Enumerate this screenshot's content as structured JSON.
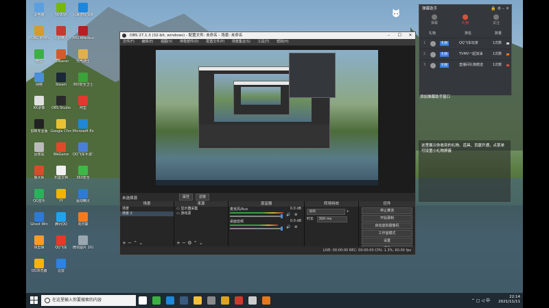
{
  "desktop_icons": [
    {
      "label": "此电脑",
      "color": "#5aa0e0"
    },
    {
      "label": "PUBG MYBSGM",
      "color": "#d89a2a"
    },
    {
      "label": "微信",
      "color": "#3cb043"
    },
    {
      "label": "网络",
      "color": "#4c8ed8"
    },
    {
      "label": "KK录像",
      "color": "#e0e0e0"
    },
    {
      "label": "剪映专业版",
      "color": "#222222"
    },
    {
      "label": "回收站",
      "color": "#bbbbbb"
    },
    {
      "label": "鲁大师",
      "color": "#d84c2c"
    },
    {
      "label": "QQ音乐",
      "color": "#2ab25a"
    },
    {
      "label": "Ghost Win",
      "color": "#2d7ad6"
    },
    {
      "label": "快剪辑",
      "color": "#ff9a2a"
    },
    {
      "label": "QQ浏览器",
      "color": "#f7b500"
    },
    {
      "label": "NVIDIA",
      "color": "#76b900"
    },
    {
      "label": "人脉精灵",
      "color": "#c23b2e"
    },
    {
      "label": "CCleaner",
      "color": "#d35b2b"
    },
    {
      "label": "Steam",
      "color": "#1b2838"
    },
    {
      "label": "OBS Studio",
      "color": "#2a2a2a"
    },
    {
      "label": "Google Chrome",
      "color": "#e8c232"
    },
    {
      "label": "WeGame",
      "color": "#e04a2a"
    },
    {
      "label": "石墨文档",
      "color": "#f0f0f0"
    },
    {
      "label": "YY",
      "color": "#f3b400"
    },
    {
      "label": "腾讯QQ",
      "color": "#22a3e8"
    },
    {
      "label": "QQ飞车",
      "color": "#e8382a"
    },
    {
      "label": "迅雷",
      "color": "#2d83e0"
    },
    {
      "label": "风暴游戏加速器",
      "color": "#1a87e0"
    },
    {
      "label": "MSI Afterburner",
      "color": "#b52020"
    },
    {
      "label": "元气骑士",
      "color": "#e2b04a"
    },
    {
      "label": "360安全卫士",
      "color": "#3aa33a"
    },
    {
      "label": "阿里",
      "color": "#e4382e"
    },
    {
      "label": "Microsoft Edge",
      "color": "#1f87d6"
    },
    {
      "label": "QQ飞车手游工具",
      "color": "#4a7fd8"
    },
    {
      "label": "360安全",
      "color": "#3db847"
    },
    {
      "label": "驱动精灵",
      "color": "#2d7ad6"
    },
    {
      "label": "向日葵",
      "color": "#f27b22"
    },
    {
      "label": "微信图片 2021.11.0",
      "color": "#9aa7b0"
    }
  ],
  "taskbar": {
    "search_placeholder": "在这里输入你要搜索的内容",
    "apps": [
      {
        "name": "task-view-icon",
        "color": "#ffffff"
      },
      {
        "name": "wechat-icon",
        "color": "#3cb043"
      },
      {
        "name": "edge-icon",
        "color": "#1f87d6"
      },
      {
        "name": "steam-icon",
        "color": "#3a5a80"
      },
      {
        "name": "file-explorer-icon",
        "color": "#f2c13a"
      },
      {
        "name": "app-icon",
        "color": "#8a8a8a"
      },
      {
        "name": "wegame-icon",
        "color": "#e0a020"
      },
      {
        "name": "app2-icon",
        "color": "#d03a2a"
      },
      {
        "name": "obs-icon",
        "color": "#cccccc"
      },
      {
        "name": "app3-icon",
        "color": "#e07a20"
      }
    ],
    "time": "22:14",
    "date": "2021/11/11"
  },
  "obs": {
    "title": "OBS 27.1.3 (32-bit, windows) - 配置文件: 未命名 - 场景: 未命名",
    "menu": [
      "文件(F)",
      "编辑(E)",
      "视图(V)",
      "停靠部件(D)",
      "配置文件(P)",
      "场景集合(S)",
      "工具(T)",
      "帮助(H)"
    ],
    "scene_status": "未选择源",
    "preview_controls": [
      "属性",
      "滤镜"
    ],
    "docks": {
      "scenes_title": "场景",
      "scenes": [
        "场景",
        "场景 2"
      ],
      "sources_title": "来源",
      "sources": [
        "显示器采集",
        "游戏源"
      ],
      "mixer_title": "混音器",
      "mixer": [
        {
          "name": "麦克风/Aux",
          "db": "0.0 dB"
        },
        {
          "name": "桌面音频",
          "db": "0.0 dB"
        }
      ],
      "transition_title": "转场特效",
      "transition_type": "淡出",
      "duration_label": "时长",
      "duration_value": "300 ms",
      "controls_title": "控件",
      "controls": [
        "停止推流",
        "开始录制",
        "启动虚拟摄像机",
        "工作室模式",
        "设置",
        "退出"
      ]
    },
    "status": "LIVE: 00:00:00   REC: 00:00:00   CPU: 1.3%, 60.00 fps"
  },
  "qq_panel": {
    "title": "弹幕助手",
    "tabs": [
      "弹幕",
      "礼物",
      "关注"
    ],
    "active_tab": "礼物",
    "subheader": [
      "礼物",
      "排名",
      "数量"
    ],
    "items": [
      {
        "rank": "1",
        "tag": "礼物",
        "name": "QQ飞车玩家",
        "count": "1次数"
      },
      {
        "rank": "2",
        "tag": "礼物",
        "name": "TVMV一起加油",
        "count": "1次数"
      },
      {
        "rank": "3",
        "tag": "礼物",
        "name": "直播间礼物赠送",
        "count": "1次数"
      }
    ],
    "note": "添加弹幕助手窗口",
    "panel_text": "这里展示你收到的礼物、道具、贡献开通，点某单可设置小礼物屏蔽"
  }
}
